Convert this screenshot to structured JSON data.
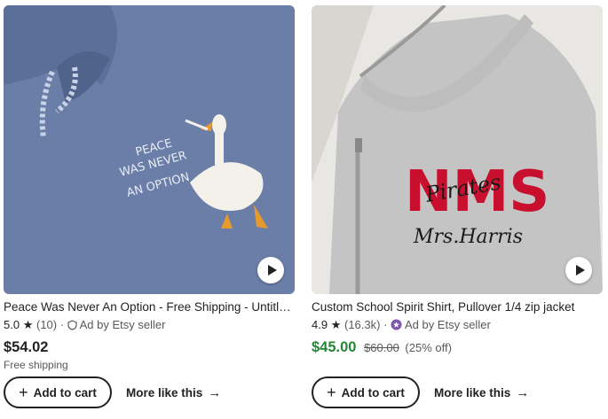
{
  "listings": [
    {
      "title": "Peace Was Never An Option - Free Shipping - Untitled Goose Hoodie",
      "rating": "5.0",
      "reviews": "(10)",
      "ad_label": "Ad by Etsy seller",
      "price": "$54.02",
      "shipping": "Free shipping",
      "add_label": "Add to cart",
      "more_label": "More like this",
      "image_text": [
        "PEACE",
        "WAS NEVER",
        "AN OPTION"
      ],
      "image_bg": "#6a7ea8"
    },
    {
      "title": "Custom School Spirit Shirt, Pullover 1/4 zip jacket",
      "rating": "4.9",
      "reviews": "(16.3k)",
      "ad_label": "Ad by Etsy seller",
      "price": "$45.00",
      "original_price": "$60.00",
      "discount": "(25% off)",
      "add_label": "Add to cart",
      "more_label": "More like this",
      "image_text": [
        "NMS",
        "Pirates",
        "Mrs.Harris"
      ],
      "image_bg": "#c7c7c7"
    }
  ],
  "colors": {
    "sale_price": "#258635",
    "text": "#222222",
    "muted": "#595959",
    "star_seller": "#7f54b3"
  },
  "icons": {
    "star": "star-icon",
    "ad": "ad-shield-icon",
    "seller": "star-seller-icon",
    "play": "play-icon",
    "plus": "plus-icon",
    "arrow": "arrow-right-icon"
  }
}
